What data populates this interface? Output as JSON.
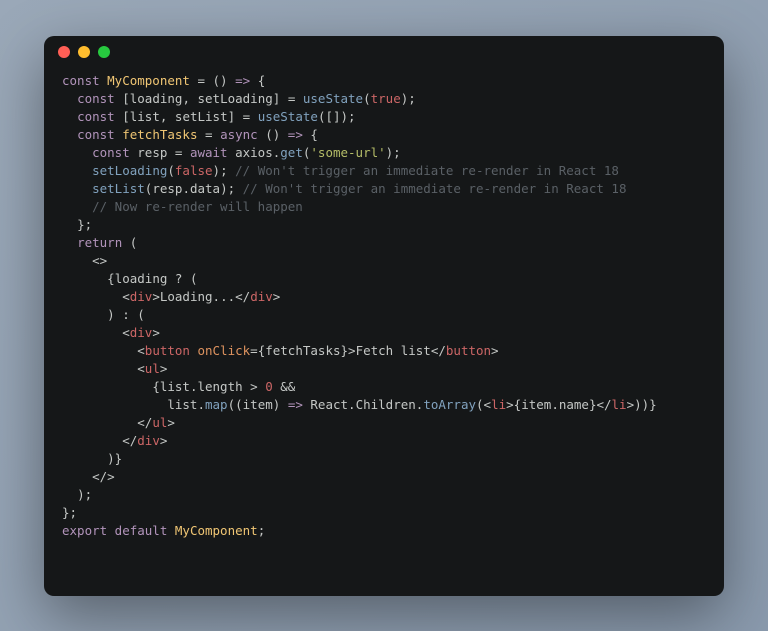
{
  "code": {
    "lines": [
      [
        {
          "cls": "kw",
          "t": "const "
        },
        {
          "cls": "ylw",
          "t": "MyComponent"
        },
        {
          "cls": "op",
          "t": " = "
        },
        {
          "cls": "punc",
          "t": "() "
        },
        {
          "cls": "kw",
          "t": "=>"
        },
        {
          "cls": "punc",
          "t": " {"
        }
      ],
      [
        {
          "cls": "",
          "t": "  "
        },
        {
          "cls": "kw",
          "t": "const "
        },
        {
          "cls": "punc",
          "t": "["
        },
        {
          "cls": "id",
          "t": "loading"
        },
        {
          "cls": "punc",
          "t": ", "
        },
        {
          "cls": "id",
          "t": "setLoading"
        },
        {
          "cls": "punc",
          "t": "] = "
        },
        {
          "cls": "fn",
          "t": "useState"
        },
        {
          "cls": "punc",
          "t": "("
        },
        {
          "cls": "bool",
          "t": "true"
        },
        {
          "cls": "punc",
          "t": ");"
        }
      ],
      [
        {
          "cls": "",
          "t": "  "
        },
        {
          "cls": "kw",
          "t": "const "
        },
        {
          "cls": "punc",
          "t": "["
        },
        {
          "cls": "id",
          "t": "list"
        },
        {
          "cls": "punc",
          "t": ", "
        },
        {
          "cls": "id",
          "t": "setList"
        },
        {
          "cls": "punc",
          "t": "] = "
        },
        {
          "cls": "fn",
          "t": "useState"
        },
        {
          "cls": "punc",
          "t": "([]);"
        }
      ],
      [
        {
          "cls": "",
          "t": "  "
        },
        {
          "cls": "kw",
          "t": "const "
        },
        {
          "cls": "ylw",
          "t": "fetchTasks"
        },
        {
          "cls": "op",
          "t": " = "
        },
        {
          "cls": "kw",
          "t": "async "
        },
        {
          "cls": "punc",
          "t": "() "
        },
        {
          "cls": "kw",
          "t": "=>"
        },
        {
          "cls": "punc",
          "t": " {"
        }
      ],
      [
        {
          "cls": "",
          "t": "    "
        },
        {
          "cls": "kw",
          "t": "const "
        },
        {
          "cls": "id",
          "t": "resp"
        },
        {
          "cls": "op",
          "t": " = "
        },
        {
          "cls": "kw",
          "t": "await "
        },
        {
          "cls": "id",
          "t": "axios"
        },
        {
          "cls": "punc",
          "t": "."
        },
        {
          "cls": "fn",
          "t": "get"
        },
        {
          "cls": "punc",
          "t": "("
        },
        {
          "cls": "str",
          "t": "'some-url'"
        },
        {
          "cls": "punc",
          "t": ");"
        }
      ],
      [
        {
          "cls": "",
          "t": "    "
        },
        {
          "cls": "fn",
          "t": "setLoading"
        },
        {
          "cls": "punc",
          "t": "("
        },
        {
          "cls": "bool",
          "t": "false"
        },
        {
          "cls": "punc",
          "t": "); "
        },
        {
          "cls": "cmt",
          "t": "// Won't trigger an immediate re-render in React 18"
        }
      ],
      [
        {
          "cls": "",
          "t": "    "
        },
        {
          "cls": "fn",
          "t": "setList"
        },
        {
          "cls": "punc",
          "t": "("
        },
        {
          "cls": "id",
          "t": "resp"
        },
        {
          "cls": "punc",
          "t": "."
        },
        {
          "cls": "id",
          "t": "data"
        },
        {
          "cls": "punc",
          "t": "); "
        },
        {
          "cls": "cmt",
          "t": "// Won't trigger an immediate re-render in React 18"
        }
      ],
      [
        {
          "cls": "",
          "t": "    "
        },
        {
          "cls": "cmt",
          "t": "// Now re-render will happen"
        }
      ],
      [
        {
          "cls": "",
          "t": "  "
        },
        {
          "cls": "punc",
          "t": "};"
        }
      ],
      [
        {
          "cls": "",
          "t": "  "
        },
        {
          "cls": "kw",
          "t": "return"
        },
        {
          "cls": "punc",
          "t": " ("
        }
      ],
      [
        {
          "cls": "",
          "t": "    "
        },
        {
          "cls": "punc",
          "t": "<>"
        }
      ],
      [
        {
          "cls": "",
          "t": "      "
        },
        {
          "cls": "punc",
          "t": "{"
        },
        {
          "cls": "id",
          "t": "loading"
        },
        {
          "cls": "op",
          "t": " ? "
        },
        {
          "cls": "punc",
          "t": "("
        }
      ],
      [
        {
          "cls": "",
          "t": "        "
        },
        {
          "cls": "punc",
          "t": "<"
        },
        {
          "cls": "tag",
          "t": "div"
        },
        {
          "cls": "punc",
          "t": ">"
        },
        {
          "cls": "txt",
          "t": "Loading..."
        },
        {
          "cls": "punc",
          "t": "</"
        },
        {
          "cls": "tag",
          "t": "div"
        },
        {
          "cls": "punc",
          "t": ">"
        }
      ],
      [
        {
          "cls": "",
          "t": "      "
        },
        {
          "cls": "punc",
          "t": ") : ("
        }
      ],
      [
        {
          "cls": "",
          "t": "        "
        },
        {
          "cls": "punc",
          "t": "<"
        },
        {
          "cls": "tag",
          "t": "div"
        },
        {
          "cls": "punc",
          "t": ">"
        }
      ],
      [
        {
          "cls": "",
          "t": "          "
        },
        {
          "cls": "punc",
          "t": "<"
        },
        {
          "cls": "tag",
          "t": "button"
        },
        {
          "cls": "",
          "t": " "
        },
        {
          "cls": "attr",
          "t": "onClick"
        },
        {
          "cls": "punc",
          "t": "={"
        },
        {
          "cls": "id",
          "t": "fetchTasks"
        },
        {
          "cls": "punc",
          "t": "}>"
        },
        {
          "cls": "txt",
          "t": "Fetch list"
        },
        {
          "cls": "punc",
          "t": "</"
        },
        {
          "cls": "tag",
          "t": "button"
        },
        {
          "cls": "punc",
          "t": ">"
        }
      ],
      [
        {
          "cls": "",
          "t": "          "
        },
        {
          "cls": "punc",
          "t": "<"
        },
        {
          "cls": "tag",
          "t": "ul"
        },
        {
          "cls": "punc",
          "t": ">"
        }
      ],
      [
        {
          "cls": "",
          "t": "            "
        },
        {
          "cls": "punc",
          "t": "{"
        },
        {
          "cls": "id",
          "t": "list"
        },
        {
          "cls": "punc",
          "t": "."
        },
        {
          "cls": "id",
          "t": "length"
        },
        {
          "cls": "op",
          "t": " > "
        },
        {
          "cls": "num",
          "t": "0"
        },
        {
          "cls": "op",
          "t": " &&"
        }
      ],
      [
        {
          "cls": "",
          "t": "              "
        },
        {
          "cls": "id",
          "t": "list"
        },
        {
          "cls": "punc",
          "t": "."
        },
        {
          "cls": "fn",
          "t": "map"
        },
        {
          "cls": "punc",
          "t": "(("
        },
        {
          "cls": "id",
          "t": "item"
        },
        {
          "cls": "punc",
          "t": ") "
        },
        {
          "cls": "kw",
          "t": "=>"
        },
        {
          "cls": "punc",
          "t": " "
        },
        {
          "cls": "id",
          "t": "React"
        },
        {
          "cls": "punc",
          "t": "."
        },
        {
          "cls": "id",
          "t": "Children"
        },
        {
          "cls": "punc",
          "t": "."
        },
        {
          "cls": "fn",
          "t": "toArray"
        },
        {
          "cls": "punc",
          "t": "(<"
        },
        {
          "cls": "tag",
          "t": "li"
        },
        {
          "cls": "punc",
          "t": ">{"
        },
        {
          "cls": "id",
          "t": "item"
        },
        {
          "cls": "punc",
          "t": "."
        },
        {
          "cls": "id",
          "t": "name"
        },
        {
          "cls": "punc",
          "t": "}</"
        },
        {
          "cls": "tag",
          "t": "li"
        },
        {
          "cls": "punc",
          "t": ">))}"
        }
      ],
      [
        {
          "cls": "",
          "t": "          "
        },
        {
          "cls": "punc",
          "t": "</"
        },
        {
          "cls": "tag",
          "t": "ul"
        },
        {
          "cls": "punc",
          "t": ">"
        }
      ],
      [
        {
          "cls": "",
          "t": "        "
        },
        {
          "cls": "punc",
          "t": "</"
        },
        {
          "cls": "tag",
          "t": "div"
        },
        {
          "cls": "punc",
          "t": ">"
        }
      ],
      [
        {
          "cls": "",
          "t": "      "
        },
        {
          "cls": "punc",
          "t": ")}"
        }
      ],
      [
        {
          "cls": "",
          "t": "    "
        },
        {
          "cls": "punc",
          "t": "</>"
        }
      ],
      [
        {
          "cls": "",
          "t": "  "
        },
        {
          "cls": "punc",
          "t": ");"
        }
      ],
      [
        {
          "cls": "punc",
          "t": "};"
        }
      ],
      [
        {
          "cls": "kw",
          "t": "export default "
        },
        {
          "cls": "ylw",
          "t": "MyComponent"
        },
        {
          "cls": "punc",
          "t": ";"
        }
      ]
    ]
  }
}
